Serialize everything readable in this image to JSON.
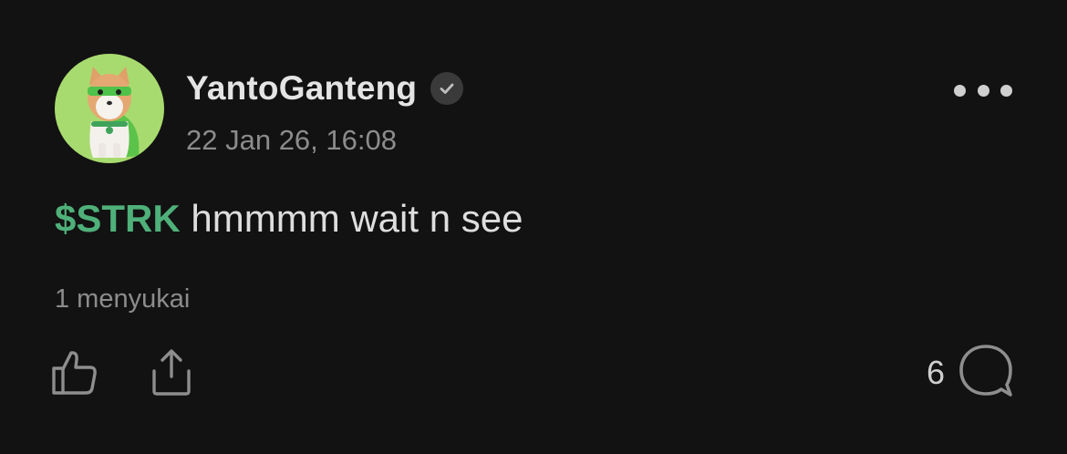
{
  "post": {
    "author": {
      "username": "YantoGanteng",
      "verified": true
    },
    "timestamp": "22 Jan 26, 16:08",
    "content": {
      "ticker": "$STRK",
      "text": " hmmmm wait n see"
    },
    "likes_text": "1 menyukai",
    "comment_count": "6"
  },
  "icons": {
    "avatar": "shiba-dog-avatar",
    "verified": "check-badge-icon",
    "more": "more-horizontal-icon",
    "like": "thumbs-up-icon",
    "share": "share-icon",
    "comment": "comment-bubble-icon"
  },
  "colors": {
    "background": "#121212",
    "ticker": "#4fb07a",
    "avatar_bg": "#a8db6f",
    "muted_text": "#8c8c8c"
  }
}
